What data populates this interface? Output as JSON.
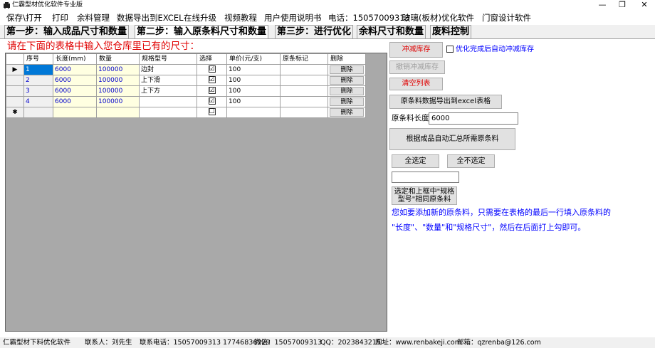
{
  "window": {
    "title": "仁霸型材优化软件专业版",
    "minimize": "—",
    "restore": "❐",
    "close": "✕"
  },
  "menu": [
    "保存\\打开",
    "打印",
    "余料管理",
    "数据导出到EXCEL",
    "在线升级",
    "视频教程",
    "用户使用说明书",
    "电话：15057009313",
    "玻璃(板材)优化软件",
    "门窗设计软件"
  ],
  "tabs": [
    "第一步：输入成品尺寸和数量",
    "第二步：输入原条料尺寸和数量",
    "第三步：进行优化",
    "余料尺寸和数量",
    "废料控制"
  ],
  "active_tab": 1,
  "instruction": "请在下面的表格中输入您仓库里已有的尺寸：",
  "grid": {
    "columns": [
      "序号",
      "长度(mm)",
      "数量",
      "规格型号",
      "选择",
      "单价(元/支)",
      "原条标记",
      "删除"
    ],
    "rows": [
      {
        "marker": "▶",
        "id": "1",
        "length": "6000",
        "qty": "100000",
        "spec": "边封",
        "checked": "☑",
        "price": "100",
        "mark": "",
        "delete": "删除"
      },
      {
        "marker": "",
        "id": "2",
        "length": "6000",
        "qty": "100000",
        "spec": "上下滑",
        "checked": "☑",
        "price": "100",
        "mark": "",
        "delete": "删除"
      },
      {
        "marker": "",
        "id": "3",
        "length": "6000",
        "qty": "100000",
        "spec": "上下方",
        "checked": "☑",
        "price": "100",
        "mark": "",
        "delete": "删除"
      },
      {
        "marker": "",
        "id": "4",
        "length": "6000",
        "qty": "100000",
        "spec": "",
        "checked": "☑",
        "price": "100",
        "mark": "",
        "delete": "删除"
      },
      {
        "marker": "✱",
        "id": "",
        "length": "",
        "qty": "",
        "spec": "",
        "checked": "☐",
        "price": "",
        "mark": "",
        "delete": "删除"
      }
    ]
  },
  "side": {
    "reduce_stock": "冲减库存",
    "auto_reduce_label": "优化完成后自动冲减库存",
    "undo_reduce": "撤销冲减库存",
    "clear_list": "清空列表",
    "export_excel": "原条料数据导出到excel表格",
    "length_label": "原条料长度",
    "length_value": "6000",
    "auto_summary": "根据成品自动汇总所需原条料",
    "select_all": "全选定",
    "deselect_all": "全不选定",
    "spec_filter_value": "",
    "select_same_spec_line1": "选定和上框中\"规格",
    "select_same_spec_line2": "型号\"相同原条料",
    "hint_line1": "您如要添加新的原条料，只需要在表格的最后一行填入原条料的",
    "hint_line2": "\"长度\"、\"数量\"和\"规格尺寸\"，然后在后面打上勾即可。"
  },
  "status": [
    "仁霸型材下料优化软件",
    "联系人：刘先生",
    "联系电话：15057009313 17746836329",
    "微信：15057009313",
    "QQ：2023843215",
    "网址：www.renbakeji.com",
    "邮箱：qzrenba@126.com"
  ]
}
